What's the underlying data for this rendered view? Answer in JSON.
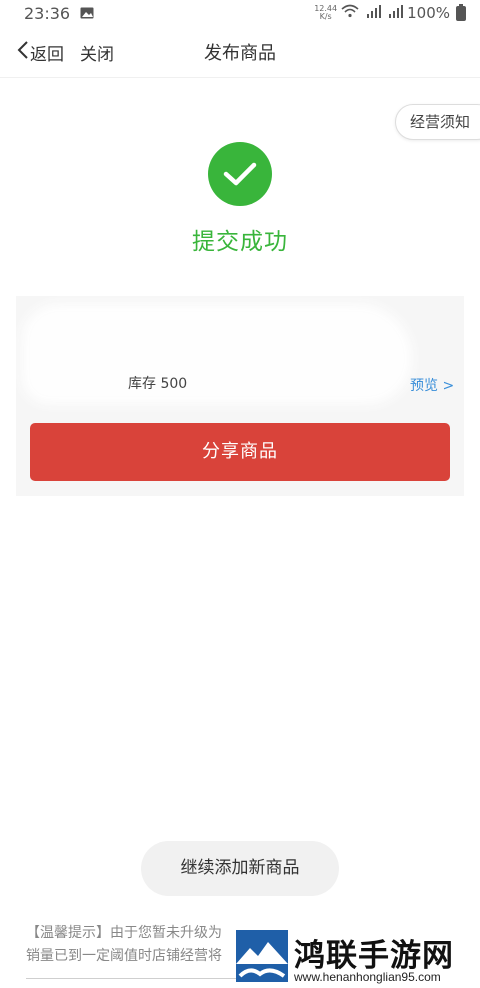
{
  "status_bar": {
    "time": "23:36",
    "net_speed_value": "12.44",
    "net_speed_unit": "K/s",
    "battery": "100%"
  },
  "nav": {
    "back_label": "返回",
    "close_label": "关闭",
    "title": "发布商品"
  },
  "notice_button_label": "经营须知",
  "success": {
    "message": "提交成功"
  },
  "product": {
    "stock_label": "库存 500",
    "preview_label": "预览 >"
  },
  "share_button_label": "分享商品",
  "continue_button_label": "继续添加新商品",
  "tip": {
    "line1": "【温馨提示】由于您暂未升级为",
    "line2": "销量已到一定阈值时店铺经营将"
  },
  "watermark": {
    "name": "鸿联手游网",
    "url": "www.henanhonglian95.com"
  },
  "colors": {
    "success_green": "#39b53b",
    "share_red": "#d9433a",
    "link_blue": "#3a8fd9"
  }
}
